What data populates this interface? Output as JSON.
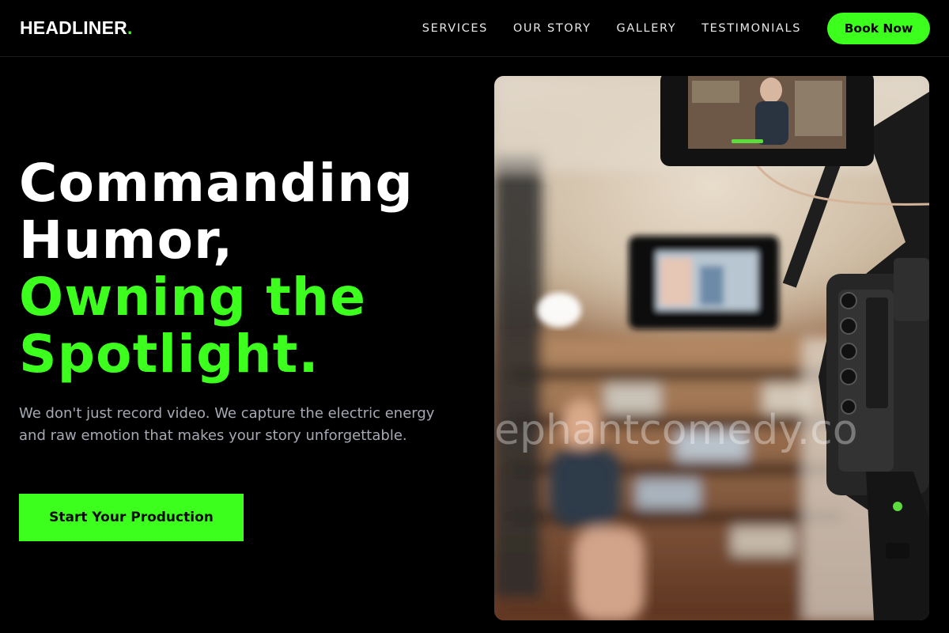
{
  "brand": {
    "name": "HEADLINER",
    "dot": "."
  },
  "nav": {
    "links": [
      "SERVICES",
      "OUR STORY",
      "GALLERY",
      "TESTIMONIALS"
    ],
    "cta": "Book Now"
  },
  "hero": {
    "title_lines": [
      "Commanding",
      "Humor,"
    ],
    "title_accent_lines": [
      "Owning the",
      "Spotlight."
    ],
    "subtitle": "We don't just record video. We capture the electric energy and raw emotion that makes your story unforgettable.",
    "cta": "Start Your Production",
    "image_watermark": "ephantcomedy.co"
  },
  "colors": {
    "accent": "#3dff1e",
    "background": "#000000",
    "muted_text": "#a6a9b3"
  }
}
